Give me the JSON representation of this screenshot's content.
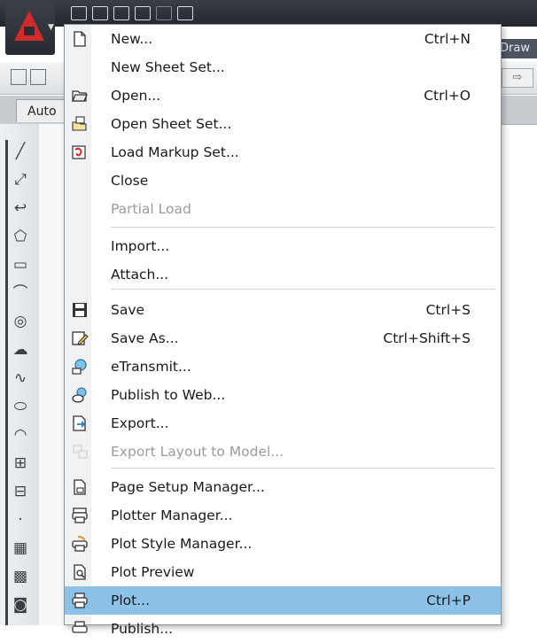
{
  "toolbar": {
    "draw_tab": "Draw",
    "doc_tab": "Auto"
  },
  "menu": {
    "items": [
      {
        "label": "New...",
        "shortcut": "Ctrl+N",
        "icon": "new-document-icon"
      },
      {
        "label": "New Sheet Set...",
        "shortcut": "",
        "icon": ""
      },
      {
        "label": "Open...",
        "shortcut": "Ctrl+O",
        "icon": "open-folder-icon"
      },
      {
        "label": "Open Sheet Set...",
        "shortcut": "",
        "icon": "open-sheet-set-icon"
      },
      {
        "label": "Load Markup Set...",
        "shortcut": "",
        "icon": "markup-set-icon"
      },
      {
        "label": "Close",
        "shortcut": "",
        "icon": ""
      },
      {
        "label": "Partial Load",
        "shortcut": "",
        "icon": "",
        "disabled": true
      },
      {
        "label": "Import...",
        "shortcut": "",
        "icon": ""
      },
      {
        "label": "Attach...",
        "shortcut": "",
        "icon": ""
      },
      {
        "label": "Save",
        "shortcut": "Ctrl+S",
        "icon": "floppy-disk-icon"
      },
      {
        "label": "Save As...",
        "shortcut": "Ctrl+Shift+S",
        "icon": "save-as-icon"
      },
      {
        "label": "eTransmit...",
        "shortcut": "",
        "icon": "etransmit-icon"
      },
      {
        "label": "Publish to Web...",
        "shortcut": "",
        "icon": "publish-web-icon"
      },
      {
        "label": "Export...",
        "shortcut": "",
        "icon": "export-icon"
      },
      {
        "label": "Export Layout to Model...",
        "shortcut": "",
        "icon": "export-layout-icon",
        "disabled": true
      },
      {
        "label": "Page Setup Manager...",
        "shortcut": "",
        "icon": "page-setup-icon"
      },
      {
        "label": "Plotter Manager...",
        "shortcut": "",
        "icon": "plotter-icon"
      },
      {
        "label": "Plot Style Manager...",
        "shortcut": "",
        "icon": "plot-style-icon"
      },
      {
        "label": "Plot Preview",
        "shortcut": "",
        "icon": "plot-preview-icon"
      },
      {
        "label": "Plot...",
        "shortcut": "Ctrl+P",
        "icon": "printer-icon",
        "highlighted": true
      },
      {
        "label": "Publish...",
        "shortcut": "",
        "icon": "publish-icon"
      }
    ]
  },
  "colors": {
    "highlight": "#8cc2e8",
    "logo_red": "#d22b2b",
    "chrome_dark": "#2a2e34"
  }
}
